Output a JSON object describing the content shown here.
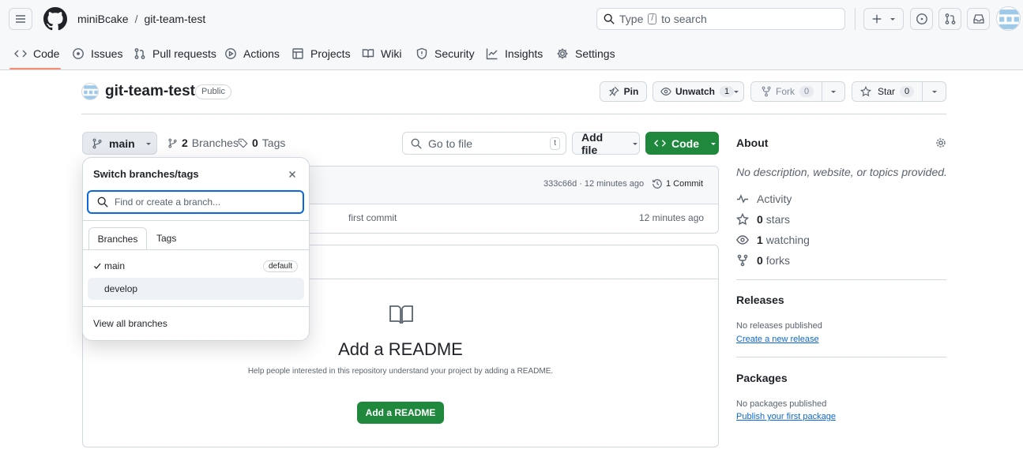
{
  "colors": {
    "accent": "#0969da",
    "primary_green": "#1f883d",
    "border": "#d1d9e0",
    "header_bg": "#f6f8fa",
    "tab_underline": "#fd8c73"
  },
  "header": {
    "owner": "miniBcake",
    "separator": "/",
    "repo": "git-team-test",
    "search_prefix": "Type",
    "search_key": "/",
    "search_suffix": "to search"
  },
  "tabs": [
    {
      "label": "Code",
      "icon": "code-icon"
    },
    {
      "label": "Issues",
      "icon": "issue-icon"
    },
    {
      "label": "Pull requests",
      "icon": "pull-request-icon"
    },
    {
      "label": "Actions",
      "icon": "play-icon"
    },
    {
      "label": "Projects",
      "icon": "table-icon"
    },
    {
      "label": "Wiki",
      "icon": "book-icon"
    },
    {
      "label": "Security",
      "icon": "shield-icon"
    },
    {
      "label": "Insights",
      "icon": "graph-icon"
    },
    {
      "label": "Settings",
      "icon": "gear-icon"
    }
  ],
  "repo_head": {
    "name": "git-team-test",
    "visibility": "Public",
    "pin": "Pin",
    "unwatch": "Unwatch",
    "unwatch_count": "1",
    "fork": "Fork",
    "fork_count": "0",
    "star": "Star",
    "star_count": "0"
  },
  "toolbar": {
    "branch": "main",
    "branches_count": "2",
    "branches_label": "Branches",
    "tags_count": "0",
    "tags_label": "Tags",
    "goto_placeholder": "Go to file",
    "goto_key": "t",
    "add_file": "Add file",
    "code": "Code"
  },
  "commit_bar": {
    "hash": "333c66d",
    "time": "12 minutes ago",
    "commits": "1 Commit"
  },
  "file_row": {
    "message": "first commit",
    "time": "12 minutes ago"
  },
  "readme": {
    "title": "Add a README",
    "desc": "Help people interested in this repository understand your project by adding a README.",
    "button": "Add a README"
  },
  "dropdown": {
    "title": "Switch branches/tags",
    "search_placeholder": "Find or create a branch...",
    "tab_branches": "Branches",
    "tab_tags": "Tags",
    "branches": [
      {
        "name": "main",
        "badge": "default",
        "checked": true
      },
      {
        "name": "develop",
        "badge": "",
        "checked": false
      }
    ],
    "view_all": "View all branches"
  },
  "about": {
    "title": "About",
    "desc": "No description, website, or topics provided.",
    "activity": "Activity",
    "stars_n": "0",
    "stars": "stars",
    "watching_n": "1",
    "watching": "watching",
    "forks_n": "0",
    "forks": "forks"
  },
  "releases": {
    "title": "Releases",
    "empty": "No releases published",
    "link": "Create a new release"
  },
  "packages": {
    "title": "Packages",
    "empty": "No packages published",
    "link": "Publish your first package"
  }
}
